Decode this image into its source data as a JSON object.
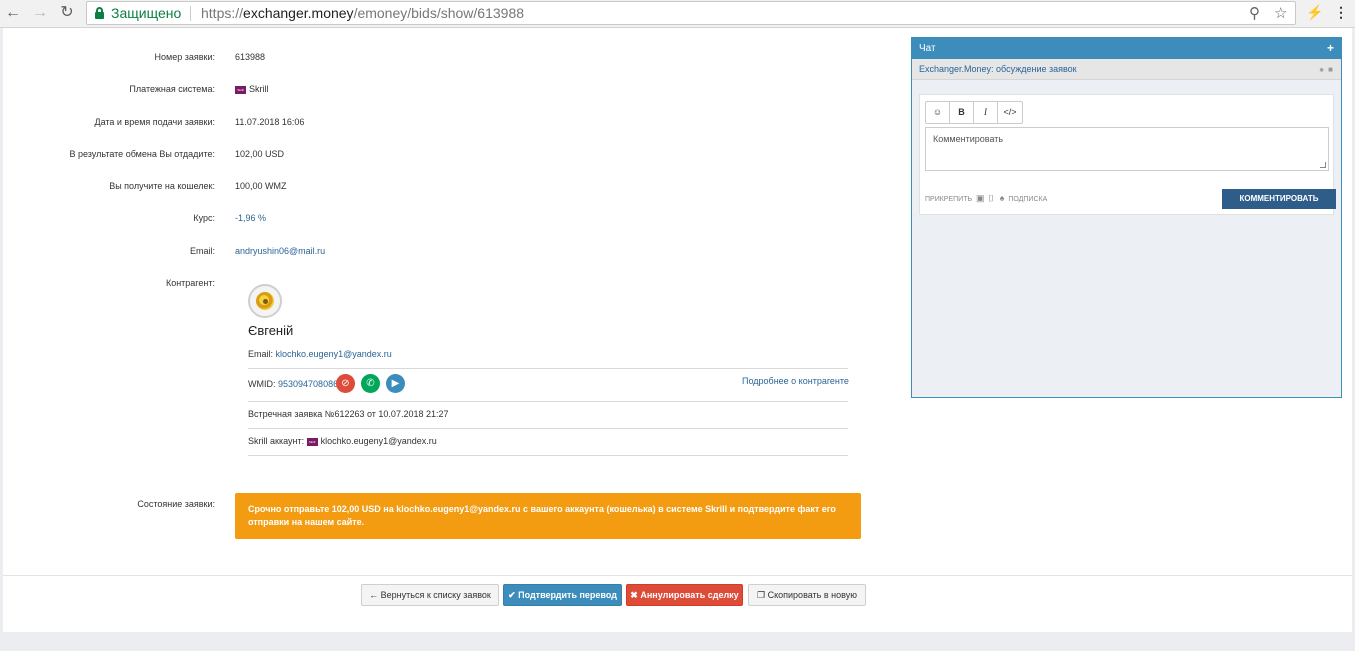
{
  "browser": {
    "secure_label": "Защищено",
    "url_scheme": "https://",
    "url_host": "exchanger.money",
    "url_path": "/emoney/bids/show/613988"
  },
  "fields": [
    {
      "label": "Номер заявки:",
      "value": "613988"
    },
    {
      "label": "Платежная система:",
      "value": "Skrill"
    },
    {
      "label": "Дата и время подачи заявки:",
      "value": "11.07.2018 16:06"
    },
    {
      "label": "В результате обмена Вы отдадите:",
      "value": "102,00 USD"
    },
    {
      "label": "Вы получите на кошелек:",
      "value": "100,00 WMZ"
    },
    {
      "label": "Курс:",
      "value": "-1,96 %"
    },
    {
      "label": "Email:",
      "value": "andryushin06@mail.ru"
    },
    {
      "label": "Контрагент:",
      "value": ""
    },
    {
      "label": "Состояние заявки:",
      "value": ""
    }
  ],
  "counterparty": {
    "name": "Євгеній",
    "email_label": "Email:",
    "email": "klochko.eugeny1@yandex.ru",
    "wmid_label": "WMID:",
    "wmid": "953094708086",
    "more_link": "Подробнее о контрагенте",
    "counter_bid": "Встречная заявка №612263 от 10.07.2018 21:27",
    "skrill_label": "Skrill аккаунт:",
    "skrill_account": "klochko.eugeny1@yandex.ru"
  },
  "status": {
    "message": "Срочно отправьте 102,00 USD на klochko.eugeny1@yandex.ru с вашего аккаунта (кошелька) в системе Skrill и подтвердите факт его отправки на нашем сайте.",
    "color": "#f39c12"
  },
  "buttons": {
    "back": "Вернуться к списку заявок",
    "confirm": "Подтвердить перевод",
    "cancel": "Аннулировать сделку",
    "copy": "Скопировать в новую"
  },
  "chat": {
    "title": "Чат",
    "subtitle": "Exchanger.Money: обсуждение заявок",
    "placeholder": "Комментировать",
    "attach_label": "ПРИКРЕПИТЬ",
    "subscribe_label": "ПОДПИСКА",
    "submit_label": "КОММЕНТИРОВАТЬ"
  },
  "colors": {
    "primary": "#3c8dbc",
    "danger": "#dd4b39",
    "success": "#00a65a",
    "warning": "#f39c12",
    "link": "#2a6496",
    "secure": "#0b8043"
  }
}
